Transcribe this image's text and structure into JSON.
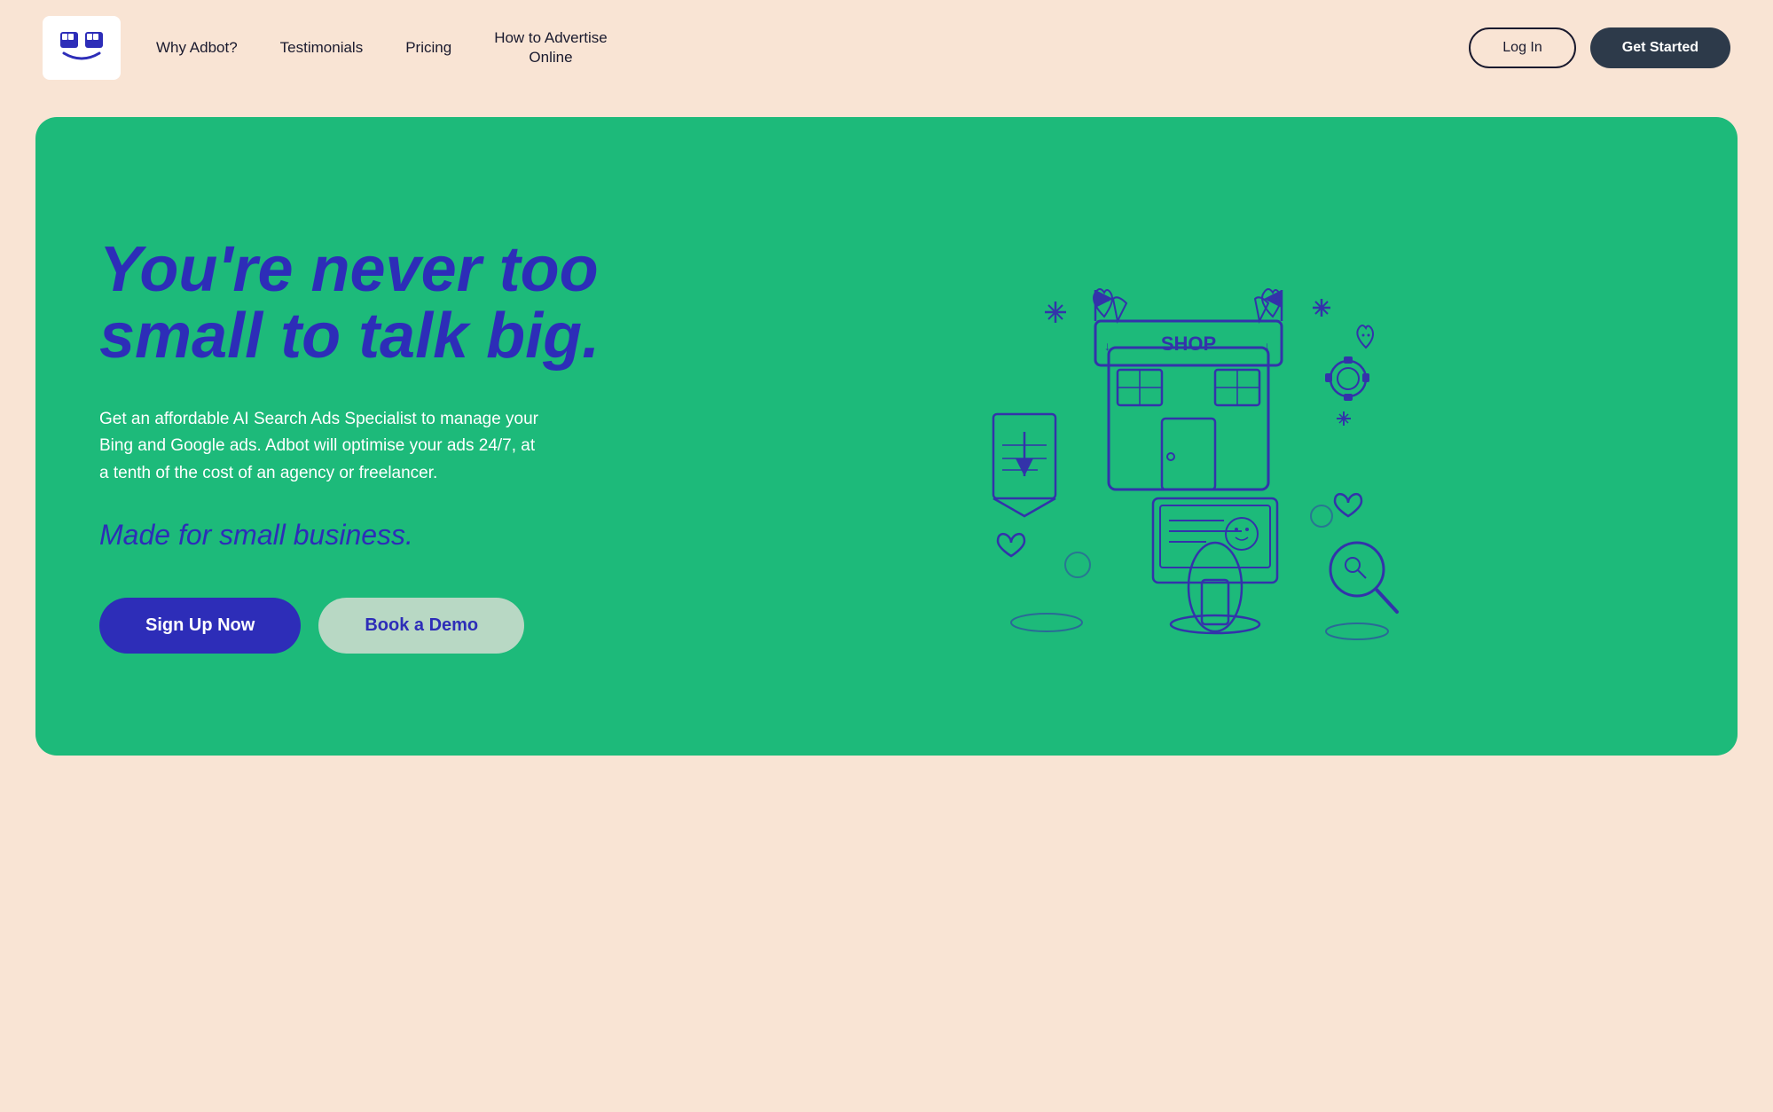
{
  "header": {
    "logo_alt": "Adbot logo",
    "nav": {
      "items": [
        {
          "id": "why-adbot",
          "label": "Why Adbot?",
          "multiline": false
        },
        {
          "id": "testimonials",
          "label": "Testimonials",
          "multiline": false
        },
        {
          "id": "pricing",
          "label": "Pricing",
          "multiline": false
        },
        {
          "id": "how-to-advertise",
          "label": "How to Advertise Online",
          "multiline": true
        }
      ]
    },
    "login_label": "Log In",
    "get_started_label": "Get Started"
  },
  "hero": {
    "headline": "You're never too small to talk big.",
    "description": "Get an affordable AI Search Ads Specialist to manage your Bing and Google ads. Adbot will optimise your ads 24/7, at a tenth of the cost of an agency or freelancer.",
    "subheading": "Made for small business.",
    "cta_primary": "Sign Up Now",
    "cta_secondary": "Book a Demo"
  },
  "colors": {
    "bg": "#f9e4d4",
    "hero_bg": "#1dba7a",
    "headline_color": "#2d2db8",
    "btn_primary_bg": "#2d2db8",
    "btn_secondary_bg": "#b8d8c4",
    "nav_dark": "#2d3a4a",
    "white": "#ffffff"
  }
}
